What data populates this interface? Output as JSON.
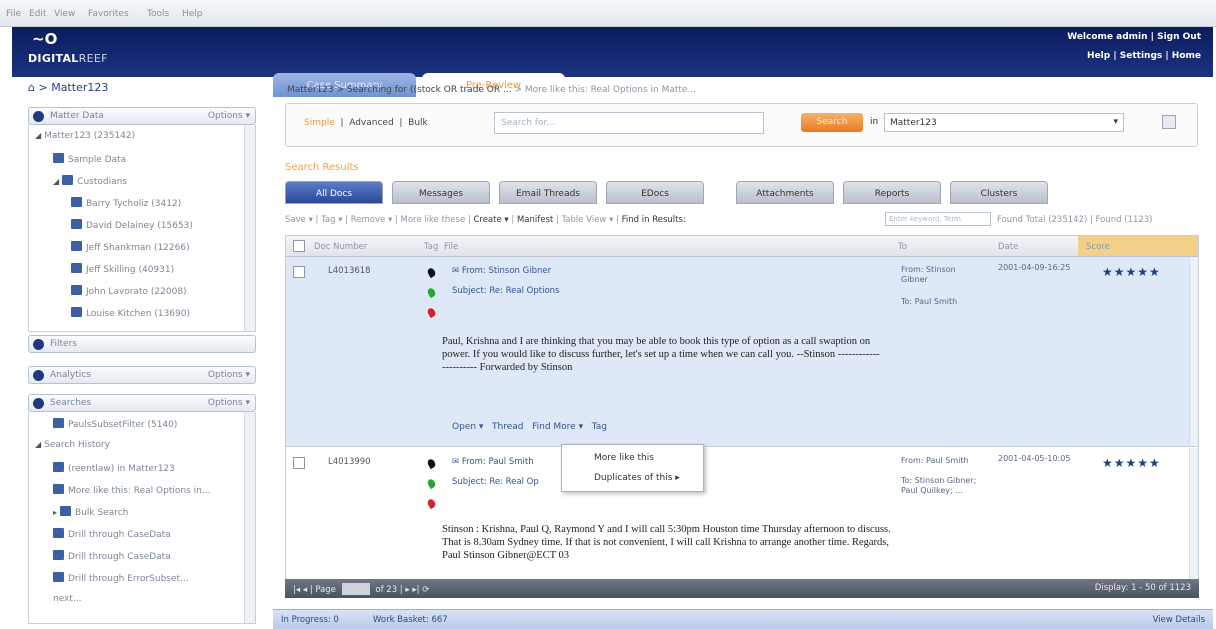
{
  "menubar": [
    "File",
    "Edit",
    "View",
    "Favorites",
    "Tools",
    "Help"
  ],
  "header": {
    "logo_mark": "~O",
    "logo_main": "DIGITAL",
    "logo_sub": "REEF",
    "welcome": "Welcome admin | Sign Out",
    "links": "Help | Settings | Home"
  },
  "tabs": [
    "Case Summary",
    "Pre-Review"
  ],
  "left": {
    "breadcrumb": "> Matter123",
    "matter_data": {
      "title": "Matter Data",
      "options": "Options ▾"
    },
    "tree": [
      {
        "label": "Matter123 (235142)",
        "indent": 0,
        "arrow": "◢",
        "icon": false
      },
      {
        "label": "Sample Data",
        "indent": 1,
        "arrow": "",
        "icon": true
      },
      {
        "label": "Custodians",
        "indent": 1,
        "arrow": "◢",
        "icon": true
      },
      {
        "label": "Barry Tycholiz (3412)",
        "indent": 2,
        "arrow": "",
        "icon": true
      },
      {
        "label": "David Delainey (15653)",
        "indent": 2,
        "arrow": "",
        "icon": true
      },
      {
        "label": "Jeff Shankman (12266)",
        "indent": 2,
        "arrow": "",
        "icon": true
      },
      {
        "label": "Jeff Skilling (40931)",
        "indent": 2,
        "arrow": "",
        "icon": true
      },
      {
        "label": "John Lavorato (22008)",
        "indent": 2,
        "arrow": "",
        "icon": true
      },
      {
        "label": "Louise Kitchen (13690)",
        "indent": 2,
        "arrow": "",
        "icon": true
      }
    ],
    "filters": "Filters",
    "analytics": {
      "title": "Analytics",
      "options": "Options ▾"
    },
    "searches": {
      "title": "Searches",
      "options": "Options ▾"
    },
    "search_tree": [
      {
        "label": "PaulsSubsetFilter (5140)",
        "indent": 1,
        "arrow": "",
        "icon": true
      },
      {
        "label": "Search History",
        "indent": 0,
        "arrow": "◢",
        "icon": false
      },
      {
        "label": "(reentlaw) in Matter123",
        "indent": 1,
        "arrow": "",
        "icon": true
      },
      {
        "label": "More like this: Real Options in...",
        "indent": 1,
        "arrow": "",
        "icon": true
      },
      {
        "label": "Bulk Search",
        "indent": 1,
        "arrow": "▸",
        "icon": true
      },
      {
        "label": "Drill through CaseData",
        "indent": 1,
        "arrow": "",
        "icon": true
      },
      {
        "label": "Drill through CaseData",
        "indent": 1,
        "arrow": "",
        "icon": true
      },
      {
        "label": "Drill through ErrorSubset...",
        "indent": 1,
        "arrow": "",
        "icon": true
      },
      {
        "label": "next...",
        "indent": 1,
        "arrow": "",
        "icon": false
      }
    ]
  },
  "main": {
    "breadcrumb_1": "Matter123",
    "breadcrumb_2": "Searching for ((stock OR trade OR ...",
    "breadcrumb_3": "More like this: Real Options in Matte...",
    "search": {
      "simple": "Simple",
      "advanced": "Advanced",
      "bulk": "Bulk",
      "placeholder": "Search for...",
      "button": "Search",
      "in": "in",
      "scope": "Matter123"
    },
    "results_title": "Search Results",
    "result_tabs": [
      "All Docs",
      "Messages",
      "Email Threads",
      "EDocs",
      "Attachments",
      "Reports",
      "Clusters"
    ],
    "toolbar": {
      "save": "Save ▾",
      "tag": "Tag ▾",
      "remove": "Remove ▾",
      "more_like": "More like these",
      "create": "Create ▾",
      "manifest": "Manifest",
      "table_view": "Table View ▾",
      "find": "Find in Results:",
      "find_placeholder": "Enter keyword, Term",
      "totals": "Found Total (235142) | Found (1123)"
    },
    "columns": [
      "Doc Number",
      "Tag",
      "File",
      "To",
      "Date",
      "Score"
    ],
    "rows": [
      {
        "doc": "L4013618",
        "from": "From: Stinson Gibner",
        "subject": "Subject: Re: Real Options",
        "body": "Paul, Krishna and I are thinking that you may be able to book this type of option as a call swaption on power. If you would like to discuss further, let's set up a time when we can call you. --Stinson ---------------------- Forwarded by Stinson",
        "to_from": "From: Stinson Gibner",
        "to": "To: Paul Smith",
        "date": "2001-04-09-16:25",
        "stars": "★★★★★"
      },
      {
        "doc": "L4013990",
        "from": "From: Paul Smith",
        "subject": "Subject: Re: Real Op",
        "body": "Stinson : Krishna, Paul Q, Raymond Y and I will call 5:30pm Houston time Thursday afternoon to discuss. That is 8.30am Sydney time. If that is not convenient, I will call Krishna to arrange another time. Regards, Paul Stinson Gibner@ECT 03",
        "to_from": "From: Paul Smith",
        "to": "To: Stinson Gibner; Paul Quilkey; ...",
        "date": "2001-04-05-10:05",
        "stars": "★★★★★"
      }
    ],
    "row_actions": {
      "open": "Open ▾",
      "thread": "Thread",
      "find_more": "Find More ▾",
      "tag": "Tag"
    },
    "popup": {
      "item1": "More like this",
      "item2": "Duplicates of this ▸"
    },
    "pager": {
      "page": "Page",
      "of": "of 23",
      "display": "Display: 1 - 50 of 1123"
    },
    "status": {
      "in_progress": "In Progress: 0",
      "work_basket": "Work Basket: 667",
      "view_details": "View Details"
    }
  }
}
